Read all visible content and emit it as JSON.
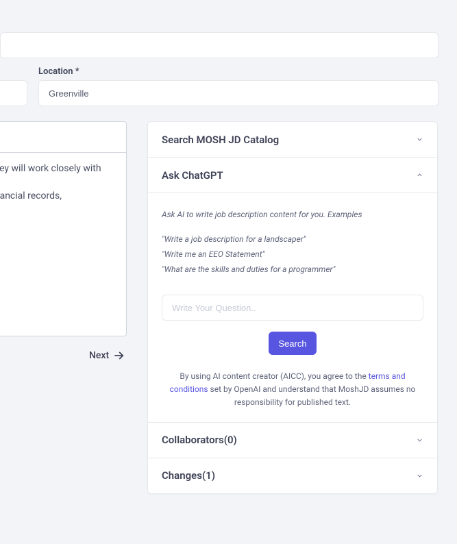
{
  "location": {
    "label": "Location *",
    "value": "Greenville"
  },
  "description": {
    "line1": "They will work closely with",
    "line2": "ate financial records,"
  },
  "next_label": "Next",
  "accordion": {
    "search_catalog": "Search MOSH JD Catalog",
    "ask_chatgpt": "Ask ChatGPT",
    "collaborators_prefix": "Collaborators",
    "collaborators_count": "(0)",
    "changes_prefix": "Changes",
    "changes_count": "(1)"
  },
  "chatgpt": {
    "intro": "Ask AI to write job description content for you. Examples",
    "examples": [
      "\"Write a job description for a landscaper\"",
      "\"Write me an EEO Statement\"",
      "\"What are the skills and duties for a programmer\""
    ],
    "placeholder": "Write Your Question..",
    "button_label": "Search",
    "disclaimer_before": "By using AI content creator (AICC), you agree to the ",
    "terms_text": "terms and conditions",
    "disclaimer_after": " set by OpenAI and understand that MoshJD assumes no responsibility for published text."
  }
}
